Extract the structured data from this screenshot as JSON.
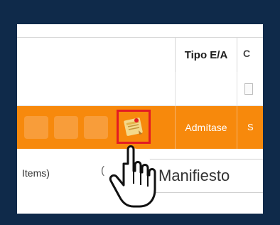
{
  "table": {
    "header": {
      "tipo_col_label": "Tipo E/A"
    },
    "selected_row": {
      "tipo_value": "Admítase"
    },
    "footer": {
      "items_label": "Items)"
    }
  },
  "tooltip": {
    "text": "Manifiesto"
  },
  "colors": {
    "frame": "#0f2a4a",
    "selected_row": "#f7890c",
    "highlight_box": "#e31b23"
  },
  "icons": {
    "note": "sticky-note-icon",
    "cursor": "hand-pointer-icon"
  }
}
